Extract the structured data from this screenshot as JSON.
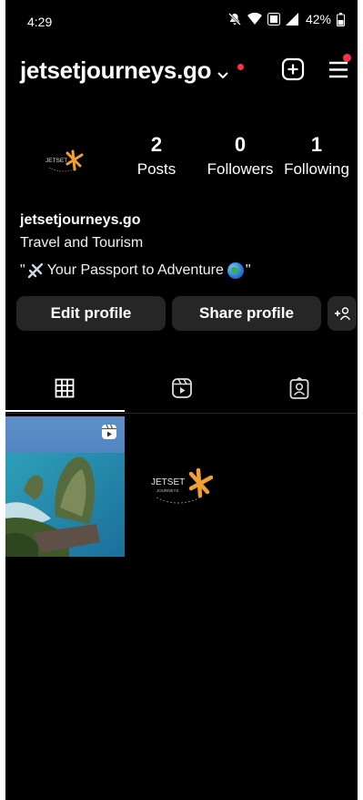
{
  "status_bar": {
    "time": "4:29",
    "battery": "42%"
  },
  "header": {
    "username": "jetsetjourneys.go",
    "icons": [
      "chevron-down-icon",
      "add-icon",
      "menu-icon"
    ],
    "notification_color": "#ff3040"
  },
  "profile": {
    "avatar_text": "JETSET",
    "stats": {
      "posts_value": "2",
      "posts_label": "Posts",
      "followers_value": "0",
      "followers_label": "Followers",
      "following_value": "1",
      "following_label": "Following"
    },
    "name": "jetsetjourneys.go",
    "category": "Travel and Tourism",
    "bio_prefix": "\"",
    "bio_text": "Your Passport to Adventure",
    "bio_suffix": "\""
  },
  "actions": {
    "edit_label": "Edit profile",
    "share_label": "Share profile"
  },
  "tabs": [
    {
      "icon": "grid-icon",
      "selected": true
    },
    {
      "icon": "reels-icon",
      "selected": false
    },
    {
      "icon": "tagged-icon",
      "selected": false
    }
  ],
  "posts": [
    {
      "type": "reel",
      "icon": "reel-badge-icon"
    },
    {
      "type": "image",
      "logo_text": "JETSET",
      "logo_subtext": "JOURNEYS"
    }
  ],
  "colors": {
    "background": "#000000",
    "button": "#262626",
    "logo_accent": "#f0a030"
  }
}
